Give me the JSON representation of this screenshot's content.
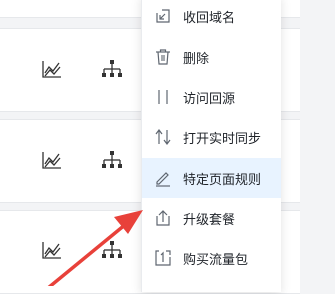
{
  "menu": {
    "items": [
      {
        "label": "收回域名",
        "icon": "domain-reclaim-icon"
      },
      {
        "label": "删除",
        "icon": "trash-icon"
      },
      {
        "label": "访问回源",
        "icon": "origin-access-icon"
      },
      {
        "label": "打开实时同步",
        "icon": "sync-arrows-icon"
      },
      {
        "label": "特定页面规则",
        "icon": "pencil-icon"
      },
      {
        "label": "升级套餐",
        "icon": "upgrade-icon"
      },
      {
        "label": "购买流量包",
        "icon": "traffic-pack-icon"
      }
    ],
    "active_index": 4
  },
  "colors": {
    "accent": "#e8f3ff",
    "annotation_arrow": "#e8413a",
    "icon": "#5f6670"
  }
}
